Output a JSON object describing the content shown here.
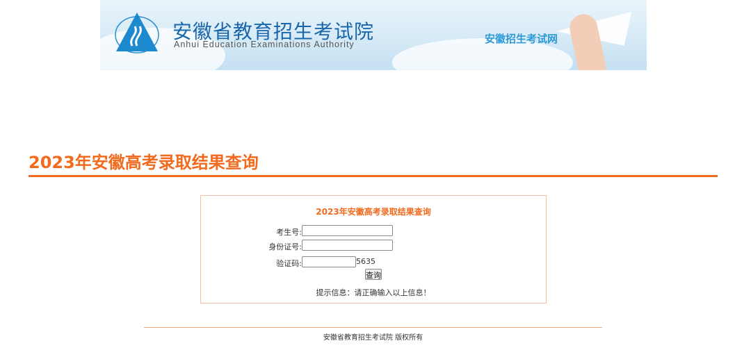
{
  "banner": {
    "title": "安徽省教育招生考试院",
    "subtitle": "Anhui Education Examinations Authority",
    "site_name": "安徽招生考试网"
  },
  "page_title": "2023年安徽高考录取结果查询",
  "form": {
    "title": "2023年安徽高考录取结果查询",
    "exam_number_label": "考生号:",
    "exam_number_value": "",
    "id_number_label": "身份证号:",
    "id_number_value": "",
    "captcha_label": "验证码:",
    "captcha_value": "",
    "captcha_code": "5635",
    "submit_label": "查询",
    "hint": "提示信息：请正确输入以上信息！"
  },
  "footer": {
    "copyright": "安徽省教育招生考试院 版权所有"
  },
  "colors": {
    "accent": "#f26a1e",
    "banner_blue": "#1a66ad"
  }
}
